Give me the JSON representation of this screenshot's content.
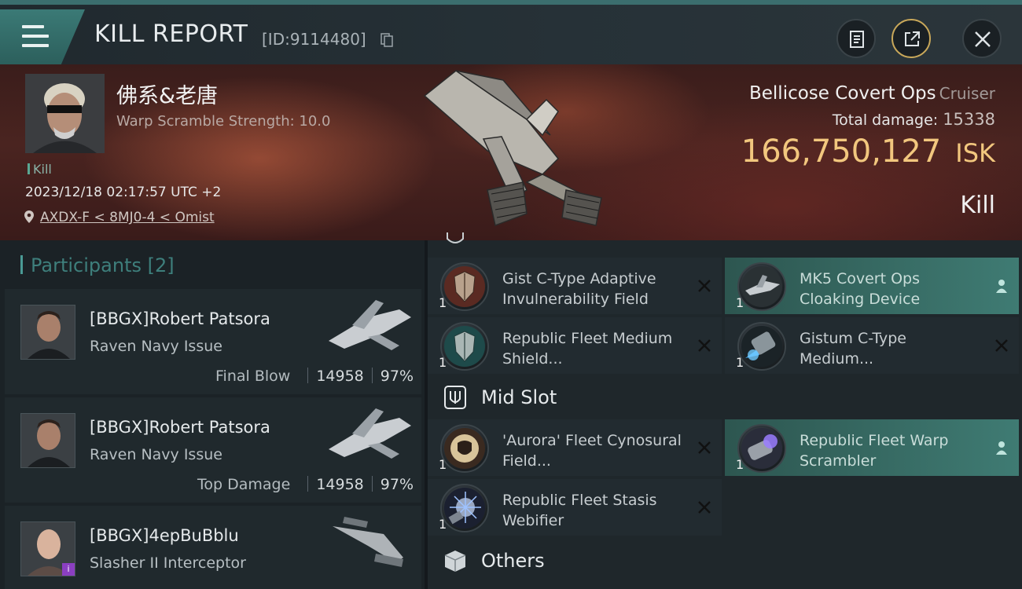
{
  "header": {
    "title": "KILL REPORT",
    "report_id": "[ID:9114480]",
    "icons": [
      "menu-icon",
      "copy-icon",
      "clipboard-icon",
      "share-icon",
      "close-icon"
    ]
  },
  "victim": {
    "name": "佛系&老唐",
    "subtitle": "Warp Scramble Strength: 10.0",
    "tag": "Kill",
    "time": "2023/12/18 02:17:57 UTC +2",
    "location": "AXDX-F < 8MJ0-4 < Omist",
    "ship_name": "Bellicose Covert Ops",
    "ship_class": "Cruiser",
    "total_damage_label": "Total damage:",
    "total_damage": "15338",
    "isk_value": "166,750,127",
    "isk_unit": "ISK",
    "result": "Kill"
  },
  "participants": {
    "label": "Participants",
    "count": "[2]",
    "rows": [
      {
        "name": "[BBGX]Robert Patsora",
        "ship": "Raven Navy Issue",
        "stat_label": "Final Blow",
        "damage": "14958",
        "percent": "97%"
      },
      {
        "name": "[BBGX]Robert Patsora",
        "ship": "Raven Navy Issue",
        "stat_label": "Top Damage",
        "damage": "14958",
        "percent": "97%"
      },
      {
        "name": "[BBGX]4epBuBblu",
        "ship": "Slasher II Interceptor",
        "stat_label": "",
        "damage": "",
        "percent": ""
      }
    ]
  },
  "modules": {
    "high": [
      {
        "name": "Gist C-Type Adaptive Invulnerability Field",
        "qty": "1",
        "status": "destroyed"
      },
      {
        "name": "MK5 Covert Ops Cloaking Device",
        "qty": "1",
        "status": "dropped"
      },
      {
        "name": "Republic Fleet Medium Shield...",
        "qty": "1",
        "status": "destroyed"
      },
      {
        "name": "Gistum C-Type Medium...",
        "qty": "1",
        "status": "destroyed"
      }
    ],
    "mid_label": "Mid Slot",
    "mid": [
      {
        "name": "'Aurora' Fleet Cynosural Field...",
        "qty": "1",
        "status": "destroyed"
      },
      {
        "name": "Republic Fleet Warp Scrambler",
        "qty": "1",
        "status": "dropped"
      },
      {
        "name": "Republic Fleet Stasis Webifier",
        "qty": "1",
        "status": "destroyed"
      }
    ],
    "others_label": "Others"
  },
  "colors": {
    "accent_teal": "#3f7b73",
    "isk_gold": "#f2c77e",
    "hero_red": "#4a2420"
  }
}
